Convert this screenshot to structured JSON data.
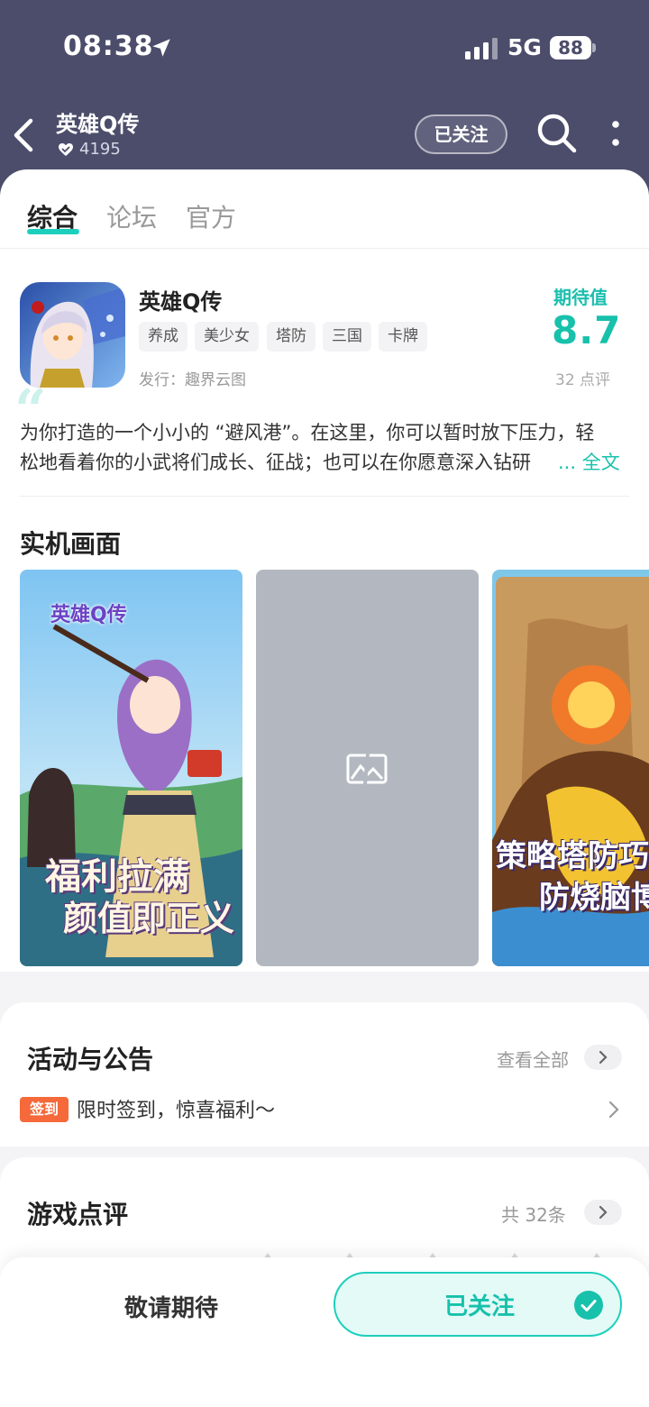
{
  "status_bar": {
    "time": "08:38",
    "network": "5G",
    "battery": "88"
  },
  "nav": {
    "title": "英雄Q传",
    "followers": "4195",
    "follow_label": "已关注"
  },
  "tabs": [
    {
      "label": "综合",
      "active": true
    },
    {
      "label": "论坛",
      "active": false
    },
    {
      "label": "官方",
      "active": false
    }
  ],
  "game": {
    "name": "英雄Q传",
    "tags": [
      "养成",
      "美少女",
      "塔防",
      "三国",
      "卡牌"
    ],
    "publisher": "发行：趣界云图",
    "expect_label": "期待值",
    "score": "8.7",
    "review_count": "32 点评",
    "description_lines": [
      "为你打造的一个小小的 “避风港”。在这里，你可以暂时放下压力，轻",
      "松地看着你的小武将们成长、征战；也可以在你愿意深入钻研"
    ],
    "read_more": "... 全文"
  },
  "screenshots": {
    "title": "实机画面",
    "captions": [
      "英雄Q传",
      "福利拉满",
      "颜值即正义",
      "策略塔防巧",
      "防烧脑博"
    ]
  },
  "activities": {
    "title": "活动与公告",
    "view_all": "查看全部",
    "badge": "签到",
    "item": "限时签到，惊喜福利～"
  },
  "reviews": {
    "title": "游戏点评",
    "total": "共 32条"
  },
  "bottom": {
    "wait_label": "敬请期待",
    "followed_label": "已关注"
  },
  "colors": {
    "header_bg": "#4c4d6b",
    "accent": "#1ccfbc",
    "badge": "#f5693a"
  }
}
